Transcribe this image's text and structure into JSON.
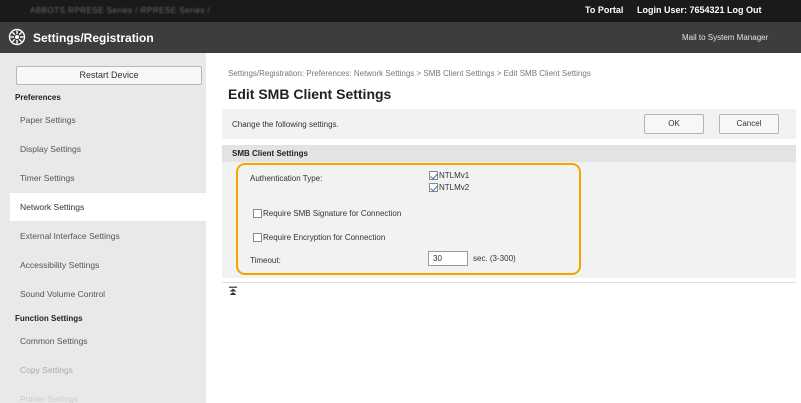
{
  "topbar": {
    "model_text": "ABBOTS  RPRESE Series / RPRESE Series /",
    "portal_label": "To Portal",
    "login_label": "Login User:  7654321  Log Out"
  },
  "titlebar": {
    "title": "Settings/Registration",
    "mail_link": "Mail to System Manager"
  },
  "sidebar": {
    "restart_label": "Restart Device",
    "preferences_heading": "Preferences",
    "preferences_items": [
      "Paper Settings",
      "Display Settings",
      "Timer Settings",
      "Network Settings",
      "External Interface Settings",
      "Accessibility Settings",
      "Sound Volume Control"
    ],
    "function_heading": "Function Settings",
    "function_items": [
      "Common Settings",
      "Copy Settings",
      "Printer Settings"
    ]
  },
  "main": {
    "breadcrumb": "Settings/Registration: Preferences: Network Settings > SMB Client Settings > Edit SMB Client Settings",
    "title": "Edit SMB Client Settings",
    "instruction": "Change the following settings.",
    "ok_label": "OK",
    "cancel_label": "Cancel",
    "section_title": "SMB Client Settings",
    "auth_type_label": "Authentication Type:",
    "auth_options": [
      {
        "label": "NTLMv1",
        "checked": true
      },
      {
        "label": "NTLMv2",
        "checked": true
      }
    ],
    "require_signature_label": "Require SMB Signature for Connection",
    "require_signature_checked": false,
    "require_encryption_label": "Require Encryption for Connection",
    "require_encryption_checked": false,
    "timeout_label": "Timeout:",
    "timeout_value": "30",
    "timeout_unit": "sec. (3-300)"
  },
  "colors": {
    "highlight": "#f5a400",
    "topbar": "#1a1a1a",
    "titlebar": "#3d3d3d",
    "sidebar": "#e9e9e9"
  }
}
